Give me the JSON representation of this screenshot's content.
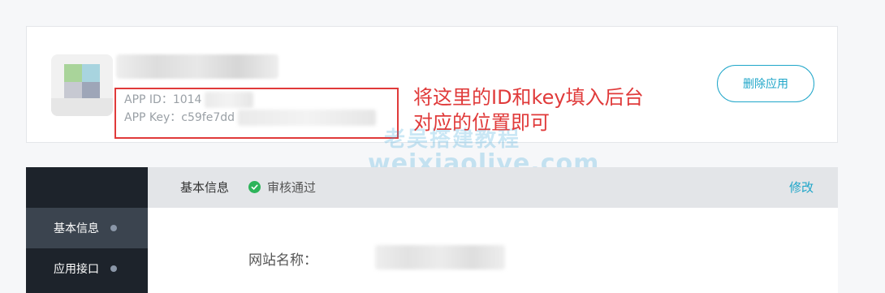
{
  "app": {
    "app_id_label": "APP ID：",
    "app_id_value": "1014",
    "app_key_label": "APP Key：",
    "app_key_value": "c59fe7dd",
    "delete_button": "删除应用"
  },
  "annotation": {
    "line1": "将这里的ID和key填入后台",
    "line2": "对应的位置即可"
  },
  "watermark": {
    "line1": "老吴搭建教程",
    "line2": "weixiaolive.com"
  },
  "sidebar": {
    "items": [
      {
        "label": "基本信息",
        "active": true
      },
      {
        "label": "应用接口",
        "active": false
      }
    ]
  },
  "main": {
    "tab_title": "基本信息",
    "status": "审核通过",
    "edit_label": "修改",
    "field_label": "网站名称："
  },
  "colors": {
    "accent": "#1fa6c9",
    "annotation_red": "#e03a3a",
    "sidebar_bg": "#1d232b",
    "success_green": "#2db45a"
  }
}
